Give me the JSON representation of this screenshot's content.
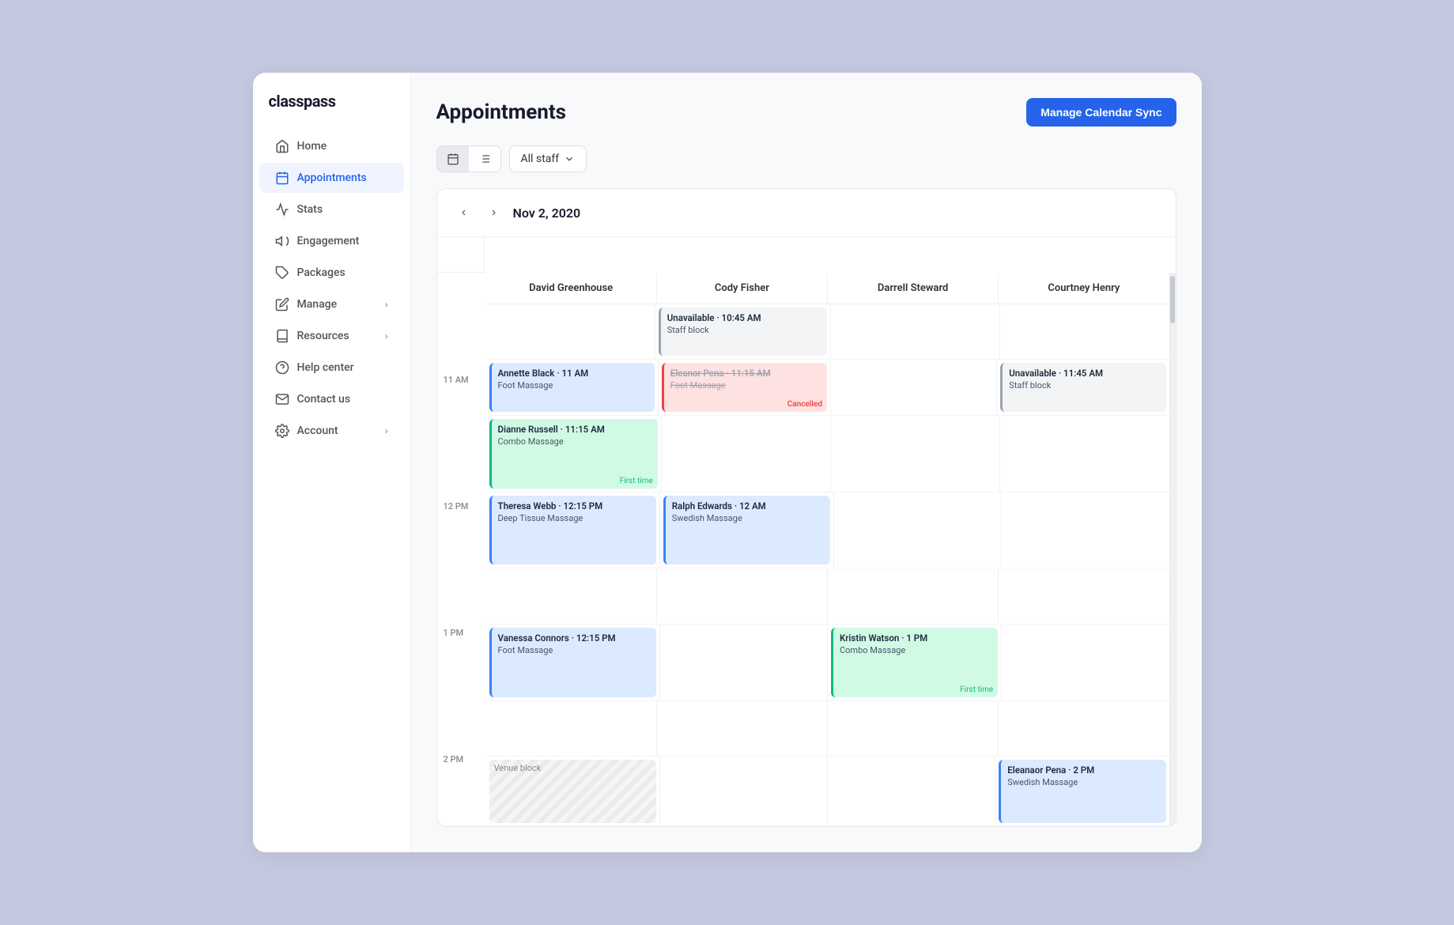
{
  "app": {
    "logo": "classpass",
    "nav": [
      {
        "id": "home",
        "label": "Home",
        "icon": "home",
        "active": false
      },
      {
        "id": "appointments",
        "label": "Appointments",
        "icon": "calendar",
        "active": true
      },
      {
        "id": "stats",
        "label": "Stats",
        "icon": "chart",
        "active": false
      },
      {
        "id": "engagement",
        "label": "Engagement",
        "icon": "megaphone",
        "active": false
      },
      {
        "id": "packages",
        "label": "Packages",
        "icon": "tag",
        "active": false
      },
      {
        "id": "manage",
        "label": "Manage",
        "icon": "edit",
        "active": false,
        "hasChevron": true
      },
      {
        "id": "resources",
        "label": "Resources",
        "icon": "book",
        "active": false,
        "hasChevron": true
      },
      {
        "id": "help-center",
        "label": "Help center",
        "icon": "help",
        "active": false
      },
      {
        "id": "contact-us",
        "label": "Contact us",
        "icon": "mail",
        "active": false
      },
      {
        "id": "account",
        "label": "Account",
        "icon": "gear",
        "active": false,
        "hasChevron": true
      }
    ]
  },
  "page": {
    "title": "Appointments"
  },
  "toolbar": {
    "staff_filter": "All staff",
    "manage_calendar_btn": "Manage Calendar Sync"
  },
  "calendar": {
    "date": "Nov 2, 2020",
    "columns": [
      {
        "id": "david",
        "label": "David Greenhouse"
      },
      {
        "id": "cody",
        "label": "Cody Fisher"
      },
      {
        "id": "darrell",
        "label": "Darrell Steward"
      },
      {
        "id": "courtney",
        "label": "Courtney Henry"
      }
    ],
    "time_slots": [
      "11 AM",
      "12 PM",
      "1 PM",
      "2 PM"
    ],
    "appointments": {
      "row_11am": {
        "david_top": {
          "type": "blue",
          "name": "Annette Black · 11 AM",
          "service": "Foot Massage"
        },
        "david_bottom": {
          "type": "green",
          "name": "Dianne Russell · 11:15 AM",
          "service": "Combo Massage",
          "badge": "First time"
        },
        "cody_unavail": {
          "type": "gray",
          "name": "Unavailable · 10:45 AM",
          "service": "Staff block"
        },
        "cody_cancelled": {
          "type": "pink",
          "name_strike": "Eleanor Pena · 11:15 AM",
          "service_strike": "Foot Massage",
          "cancelled": "Cancelled"
        },
        "courtney_unavail": {
          "type": "gray",
          "name": "Unavailable · 11:45 AM",
          "service": "Staff block"
        }
      },
      "row_12pm": {
        "cody_ralph": {
          "type": "blue",
          "name": "Ralph Edwards · 12 AM",
          "service": "Swedish Massage"
        },
        "david_theresa": {
          "type": "blue",
          "name": "Theresa Webb · 12:15 PM",
          "service": "Deep Tissue Massage"
        }
      },
      "row_1pm": {
        "david_vanessa": {
          "type": "blue",
          "name": "Vanessa Connors · 12:15 PM",
          "service": "Foot Massage"
        },
        "darrell_kristin": {
          "type": "green",
          "name": "Kristin Watson · 1 PM",
          "service": "Combo Massage",
          "badge": "First time"
        }
      },
      "row_2pm": {
        "david_venue": {
          "type": "venue",
          "label": "Venue block"
        },
        "courtney_eleanor": {
          "type": "blue",
          "name": "Eleanaor Pena · 2 PM",
          "service": "Swedish Massage"
        }
      }
    }
  }
}
